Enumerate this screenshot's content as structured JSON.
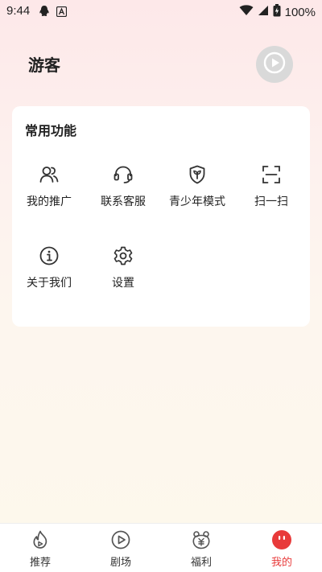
{
  "status_bar": {
    "time": "9:44",
    "battery": "100%"
  },
  "header": {
    "user_name": "游客"
  },
  "functions_card": {
    "title": "常用功能",
    "items": [
      {
        "label": "我的推广",
        "icon": "users-icon"
      },
      {
        "label": "联系客服",
        "icon": "headset-icon"
      },
      {
        "label": "青少年模式",
        "icon": "shield-sprout-icon"
      },
      {
        "label": "扫一扫",
        "icon": "scan-icon"
      },
      {
        "label": "关于我们",
        "icon": "info-icon"
      },
      {
        "label": "设置",
        "icon": "gear-icon"
      }
    ]
  },
  "bottom_nav": {
    "items": [
      {
        "label": "推荐",
        "icon": "flame-icon"
      },
      {
        "label": "剧场",
        "icon": "play-icon"
      },
      {
        "label": "福利",
        "icon": "welfare-icon"
      },
      {
        "label": "我的",
        "icon": "mine-face-icon",
        "active": true
      }
    ]
  },
  "colors": {
    "accent": "#e83a3a",
    "icon": "#333333",
    "avatar_bg": "#d9d9d9"
  }
}
